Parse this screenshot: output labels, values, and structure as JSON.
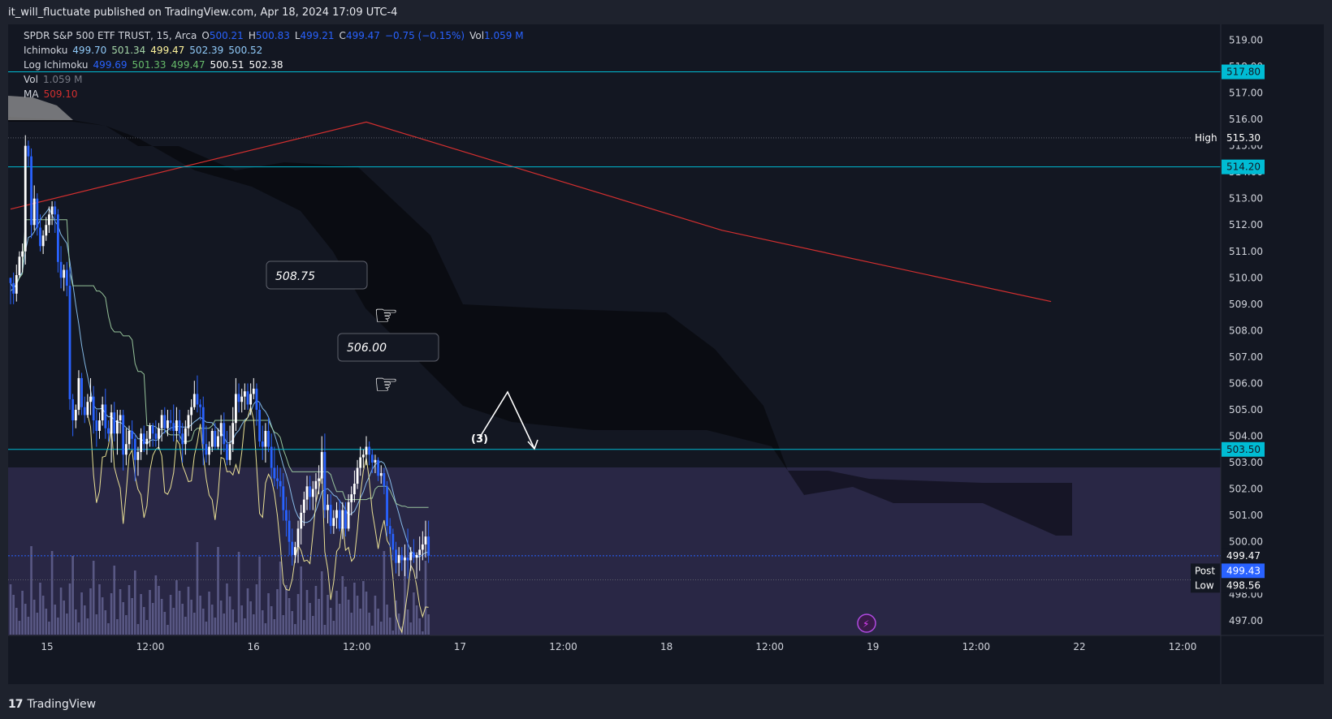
{
  "publish_line": "it_will_fluctuate published on TradingView.com, Apr 18, 2024 17:09 UTC-4",
  "legend": {
    "symbol": "SPDR S&P 500 ETF TRUST, 15, Arca",
    "open_label": "O",
    "open": "500.21",
    "high_label": "H",
    "high": "500.83",
    "low_label": "L",
    "low": "499.21",
    "close_label": "C",
    "close": "499.47",
    "change": "−0.75 (−0.15%)",
    "vol_label": "Vol",
    "vol": "1.059 M",
    "ichimoku_label": "Ichimoku",
    "ichimoku_values": [
      "499.70",
      "501.34",
      "499.47",
      "502.39",
      "500.52"
    ],
    "log_ichimoku_label": "Log Ichimoku",
    "log_ichimoku_values": [
      "499.69",
      "501.33",
      "499.47",
      "500.51",
      "502.38"
    ],
    "volume_label": "Vol",
    "volume_value": "1.059 M",
    "ma_label": "MA",
    "ma_value": "509.10"
  },
  "annotations": {
    "label1": "508.75",
    "label2": "506.00",
    "pattern_label": "(3)"
  },
  "price_axis": {
    "ticks": [
      "519.00",
      "518.00",
      "517.00",
      "516.00",
      "515.00",
      "514.00",
      "513.00",
      "512.00",
      "511.00",
      "510.00",
      "509.00",
      "508.00",
      "507.00",
      "506.00",
      "505.00",
      "504.00",
      "503.00",
      "502.00",
      "501.00",
      "500.00",
      "499.00",
      "498.00",
      "497.00"
    ],
    "h1_label": "517.80",
    "high_tag": "High",
    "high_value": "515.30",
    "h2_label": "514.20",
    "h3_label": "503.50",
    "last_price": "499.47",
    "post_tag": "Post",
    "post_value": "499.43",
    "low_tag": "Low",
    "low_value": "498.56"
  },
  "time_axis": [
    "15",
    "12:00",
    "16",
    "12:00",
    "17",
    "12:00",
    "18",
    "12:00",
    "19",
    "12:00",
    "22",
    "12:00"
  ],
  "footer": {
    "brand": "TradingView"
  },
  "colors": {
    "bg": "#131722",
    "up": "#ffffff",
    "down": "#2962ff",
    "ma": "#d32f2f",
    "hline": "#00bcd4",
    "cloud": "#000000",
    "volume": "#6a6a9a",
    "yellow": "#fff59d",
    "green": "#a5d6a7",
    "blue": "#90caf9"
  },
  "chart_data": {
    "type": "candlestick",
    "ylim": [
      496.7,
      519.6
    ],
    "horizontal_lines": [
      517.8,
      514.2,
      503.5
    ],
    "ma_line": [
      [
        0,
        512.6
      ],
      [
        120,
        515.9
      ],
      [
        240,
        511.8
      ],
      [
        351,
        509.1
      ]
    ],
    "candles": [
      [
        510,
        510,
        509,
        509.8
      ],
      [
        509.8,
        510.2,
        509,
        509.4
      ],
      [
        509.4,
        510.5,
        509.1,
        510.1
      ],
      [
        510.1,
        511,
        510,
        510.8
      ],
      [
        510.8,
        511.3,
        510.2,
        511
      ],
      [
        511,
        515.4,
        510.5,
        515
      ],
      [
        515,
        515.2,
        514.2,
        514.6
      ],
      [
        514.6,
        514.9,
        511.5,
        512
      ],
      [
        512,
        513.5,
        511.8,
        513
      ],
      [
        513,
        513.2,
        511.6,
        511.9
      ],
      [
        511.9,
        512.4,
        511,
        511.2
      ],
      [
        511.2,
        511.8,
        510.9,
        511.6
      ],
      [
        511.6,
        512.3,
        511.4,
        512
      ],
      [
        512,
        512.7,
        511.7,
        512.4
      ],
      [
        512.4,
        512.9,
        512,
        512.7
      ],
      [
        512.7,
        512.9,
        511.7,
        512.4
      ],
      [
        512.4,
        512.6,
        510.2,
        510.6
      ],
      [
        510.6,
        511.2,
        509.6,
        510
      ],
      [
        510,
        510.5,
        509.5,
        510.3
      ],
      [
        510.3,
        510.6,
        509.3,
        509.7
      ],
      [
        509.7,
        510.4,
        505,
        505.4
      ],
      [
        505.4,
        505.6,
        504,
        504.6
      ],
      [
        504.6,
        505.2,
        504.3,
        505
      ],
      [
        505,
        506.5,
        504.8,
        506.2
      ],
      [
        506.2,
        506.4,
        504.8,
        505.1
      ],
      [
        505.1,
        505.5,
        504.5,
        504.8
      ],
      [
        504.8,
        505.6,
        504.7,
        505.3
      ],
      [
        505.3,
        506.2,
        504.8,
        505.5
      ],
      [
        505.5,
        505.9,
        504.1,
        504.6
      ],
      [
        504.6,
        505,
        503.6,
        504.2
      ],
      [
        504.2,
        504.9,
        503.9,
        504.6
      ],
      [
        504.6,
        505.5,
        504.4,
        505.2
      ],
      [
        505.2,
        505.8,
        503.9,
        504.3
      ],
      [
        504.3,
        504.6,
        503.8,
        504.1
      ],
      [
        504.1,
        505.2,
        503,
        504.9
      ],
      [
        504.9,
        505.3,
        503.8,
        504.1
      ],
      [
        504.1,
        505,
        503.3,
        504.6
      ],
      [
        504.6,
        505,
        504.1,
        504.8
      ],
      [
        504.8,
        505,
        502.7,
        503.3
      ],
      [
        503.3,
        504.3,
        502.9,
        503.7
      ],
      [
        503.7,
        504.4,
        503.5,
        504.2
      ],
      [
        504.2,
        504.6,
        503.5,
        503.9
      ],
      [
        503.9,
        504.1,
        502.3,
        503.1
      ],
      [
        503.1,
        503.6,
        502.5,
        503.4
      ],
      [
        503.4,
        504.3,
        503.1,
        504.1
      ],
      [
        504.1,
        504.4,
        503.4,
        503.7
      ],
      [
        503.7,
        504.2,
        503.3,
        503.9
      ],
      [
        503.9,
        504.5,
        503.6,
        504.4
      ],
      [
        504.4,
        504.5,
        503.6,
        504.1
      ],
      [
        504.1,
        504.6,
        503.6,
        503.9
      ],
      [
        503.9,
        504.5,
        503.5,
        504.3
      ],
      [
        504.3,
        505,
        503.8,
        504.8
      ],
      [
        504.8,
        505.1,
        504.1,
        504.3
      ],
      [
        504.3,
        505,
        504,
        504.6
      ],
      [
        504.6,
        505,
        504.2,
        504.5
      ],
      [
        504.5,
        505.2,
        503.8,
        504.2
      ],
      [
        504.2,
        505.1,
        503.9,
        504.6
      ],
      [
        504.6,
        505,
        503.8,
        504.1
      ],
      [
        504.1,
        504.5,
        503,
        503.7
      ],
      [
        503.7,
        504.6,
        503.3,
        504.3
      ],
      [
        504.3,
        505,
        504,
        504.8
      ],
      [
        504.8,
        505.4,
        504.2,
        505.1
      ],
      [
        505.1,
        506.1,
        505,
        505.6
      ],
      [
        505.6,
        506.3,
        504.9,
        505.2
      ],
      [
        505.2,
        505.4,
        504.6,
        505.1
      ],
      [
        505.1,
        505.5,
        502.9,
        503.7
      ],
      [
        503.7,
        504.4,
        503,
        503.3
      ],
      [
        503.3,
        503.8,
        502.9,
        503.6
      ],
      [
        503.6,
        504.3,
        503.4,
        504.2
      ],
      [
        504.2,
        504.5,
        503.5,
        503.6
      ],
      [
        503.6,
        504.3,
        503.5,
        504
      ],
      [
        504,
        504.8,
        503.3,
        504.5
      ],
      [
        504.5,
        504.9,
        503.4,
        503.7
      ],
      [
        503.7,
        504.2,
        502.9,
        503.1
      ],
      [
        503.1,
        504.4,
        502.9,
        503.7
      ],
      [
        503.7,
        505.1,
        503.4,
        504.5
      ],
      [
        504.5,
        506.2,
        504.2,
        505.6
      ],
      [
        505.6,
        506,
        504.9,
        505.3
      ],
      [
        505.3,
        505.8,
        504.9,
        505.5
      ],
      [
        505.5,
        506,
        505,
        505.7
      ],
      [
        505.7,
        506,
        505,
        505.2
      ],
      [
        505.2,
        506,
        504.8,
        505.6
      ],
      [
        505.6,
        506.2,
        505.4,
        505.8
      ],
      [
        505.8,
        506,
        504.4,
        505
      ],
      [
        505,
        505.3,
        503.6,
        503.8
      ],
      [
        503.8,
        504.4,
        503.1,
        503.6
      ],
      [
        503.6,
        504.5,
        503,
        504.2
      ],
      [
        504.2,
        504.7,
        503.4,
        503.6
      ],
      [
        503.6,
        504.1,
        502.4,
        502.8
      ],
      [
        502.8,
        503.6,
        502.1,
        502.4
      ],
      [
        502.4,
        502.9,
        502,
        502.3
      ],
      [
        502.3,
        502.8,
        501.7,
        502.1
      ],
      [
        502.1,
        502.6,
        500.8,
        501.2
      ],
      [
        501.2,
        501.7,
        500.2,
        500.8
      ],
      [
        500.8,
        501.2,
        499.5,
        500
      ],
      [
        500,
        500.5,
        499.1,
        499.5
      ],
      [
        499.5,
        500,
        499.2,
        499.8
      ],
      [
        499.8,
        500.8,
        499.2,
        500.5
      ],
      [
        500.5,
        501.4,
        499.9,
        501.1
      ],
      [
        501.1,
        501.9,
        500.6,
        501.6
      ],
      [
        501.6,
        502.5,
        501.2,
        502.1
      ],
      [
        502.1,
        502.5,
        501.2,
        501.7
      ],
      [
        501.7,
        502.3,
        501.2,
        502
      ],
      [
        502,
        502.6,
        501.5,
        502.3
      ],
      [
        502.3,
        502.9,
        501.8,
        502.4
      ],
      [
        502.4,
        504,
        502.2,
        503.4
      ],
      [
        503.4,
        504.1,
        500.9,
        501.2
      ],
      [
        501.2,
        501.8,
        500.7,
        501.4
      ],
      [
        501.4,
        501.8,
        500.3,
        500.6
      ],
      [
        500.6,
        501.2,
        500.3,
        500.9
      ],
      [
        500.9,
        501.5,
        500.5,
        501.2
      ],
      [
        501.2,
        501.6,
        500.4,
        500.5
      ],
      [
        500.5,
        501.5,
        500.1,
        501.2
      ],
      [
        501.2,
        501.5,
        500.2,
        500.5
      ],
      [
        500.5,
        501.8,
        500.4,
        501.5
      ],
      [
        501.5,
        502.1,
        501,
        501.8
      ],
      [
        501.8,
        502.7,
        501.5,
        502.2
      ],
      [
        502.2,
        503.1,
        502,
        502.8
      ],
      [
        502.8,
        503.6,
        502.5,
        503.2
      ],
      [
        503.2,
        503.5,
        502.8,
        503.3
      ],
      [
        503.3,
        504,
        502.9,
        503.6
      ],
      [
        503.6,
        503.8,
        502.9,
        503.3
      ],
      [
        503.3,
        503.5,
        502.6,
        503
      ],
      [
        503,
        503.3,
        502.6,
        503.1
      ],
      [
        503.1,
        503.2,
        502.3,
        502.5
      ],
      [
        502.5,
        502.9,
        502.2,
        502.6
      ],
      [
        502.6,
        502.8,
        501.8,
        502.1
      ],
      [
        502.1,
        502.3,
        500.2,
        500.6
      ],
      [
        500.6,
        500.9,
        499.8,
        500.3
      ],
      [
        500.3,
        500.5,
        499.3,
        499.7
      ],
      [
        499.7,
        500,
        498.8,
        499.2
      ],
      [
        499.2,
        499.8,
        498.7,
        499.5
      ],
      [
        499.5,
        499.8,
        498.9,
        499.3
      ],
      [
        499.3,
        499.9,
        498.7,
        499.4
      ],
      [
        499.4,
        500.5,
        498.6,
        499.3
      ],
      [
        499.3,
        499.8,
        498.9,
        499.6
      ],
      [
        499.6,
        500.1,
        499.2,
        499.4
      ],
      [
        499.4,
        499.6,
        498.6,
        499.5
      ],
      [
        499.5,
        500.2,
        498.9,
        499.7
      ],
      [
        499.7,
        500.4,
        499.3,
        499.9
      ],
      [
        499.9,
        500.8,
        499.4,
        500.2
      ],
      [
        500.2,
        500.8,
        499.2,
        499.47
      ]
    ]
  }
}
